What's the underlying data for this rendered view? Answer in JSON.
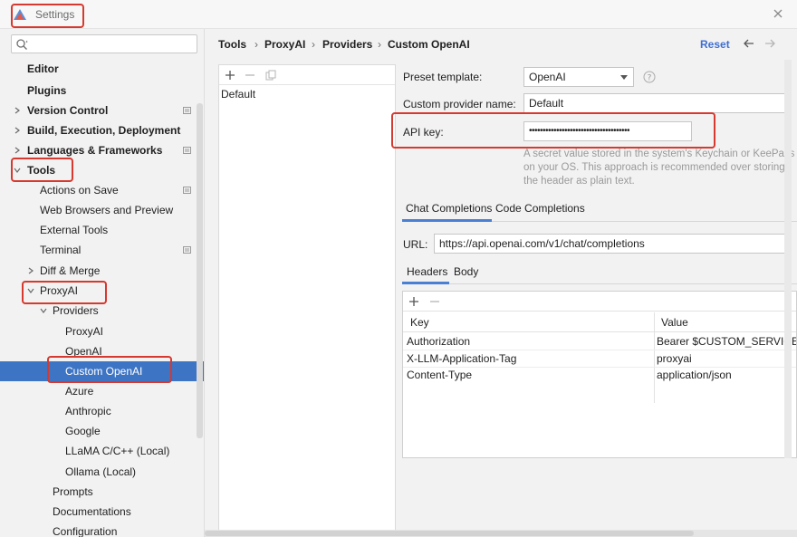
{
  "window": {
    "title": "Settings"
  },
  "sidebar": {
    "search_placeholder": "",
    "items": [
      {
        "label": "Editor"
      },
      {
        "label": "Plugins"
      },
      {
        "label": "Version Control"
      },
      {
        "label": "Build, Execution, Deployment"
      },
      {
        "label": "Languages & Frameworks"
      },
      {
        "label": "Tools"
      },
      {
        "label": "Actions on Save"
      },
      {
        "label": "Web Browsers and Preview"
      },
      {
        "label": "External Tools"
      },
      {
        "label": "Terminal"
      },
      {
        "label": "Diff & Merge"
      },
      {
        "label": "ProxyAI"
      },
      {
        "label": "Providers"
      },
      {
        "label": "ProxyAI"
      },
      {
        "label": "OpenAI"
      },
      {
        "label": "Custom OpenAI"
      },
      {
        "label": "Azure"
      },
      {
        "label": "Anthropic"
      },
      {
        "label": "Google"
      },
      {
        "label": "LLaMA C/C++ (Local)"
      },
      {
        "label": "Ollama (Local)"
      },
      {
        "label": "Prompts"
      },
      {
        "label": "Documentations"
      },
      {
        "label": "Configuration"
      }
    ]
  },
  "breadcrumb": [
    "Tools",
    "ProxyAI",
    "Providers",
    "Custom OpenAI"
  ],
  "header": {
    "reset_label": "Reset"
  },
  "provider_list": {
    "items": [
      "Default"
    ]
  },
  "form": {
    "preset_template_label": "Preset template:",
    "preset_template_value": "OpenAI",
    "provider_name_label": "Custom provider name:",
    "provider_name_value": "Default",
    "api_key_label": "API key:",
    "api_key_value": "•••••••••••••••••••••••••••••••••••••",
    "api_key_hint_1": "A secret value stored in the system's Keychain or KeePass",
    "api_key_hint_2": "on your OS. This approach is recommended over storing",
    "api_key_hint_3": "the header as plain text."
  },
  "tabs": [
    "Chat Completions",
    "Code Completions"
  ],
  "url": {
    "label": "URL:",
    "value": "https://api.openai.com/v1/chat/completions"
  },
  "subtabs": [
    "Headers",
    "Body"
  ],
  "headers_table": {
    "columns": [
      "Key",
      "Value"
    ],
    "rows": [
      {
        "key": "Authorization",
        "value": "Bearer $CUSTOM_SERVICE_A"
      },
      {
        "key": "X-LLM-Application-Tag",
        "value": "proxyai"
      },
      {
        "key": "Content-Type",
        "value": "application/json"
      }
    ]
  },
  "colors": {
    "accent": "#3d74c4",
    "highlight": "#d6392f",
    "link": "#3f6fd1"
  }
}
